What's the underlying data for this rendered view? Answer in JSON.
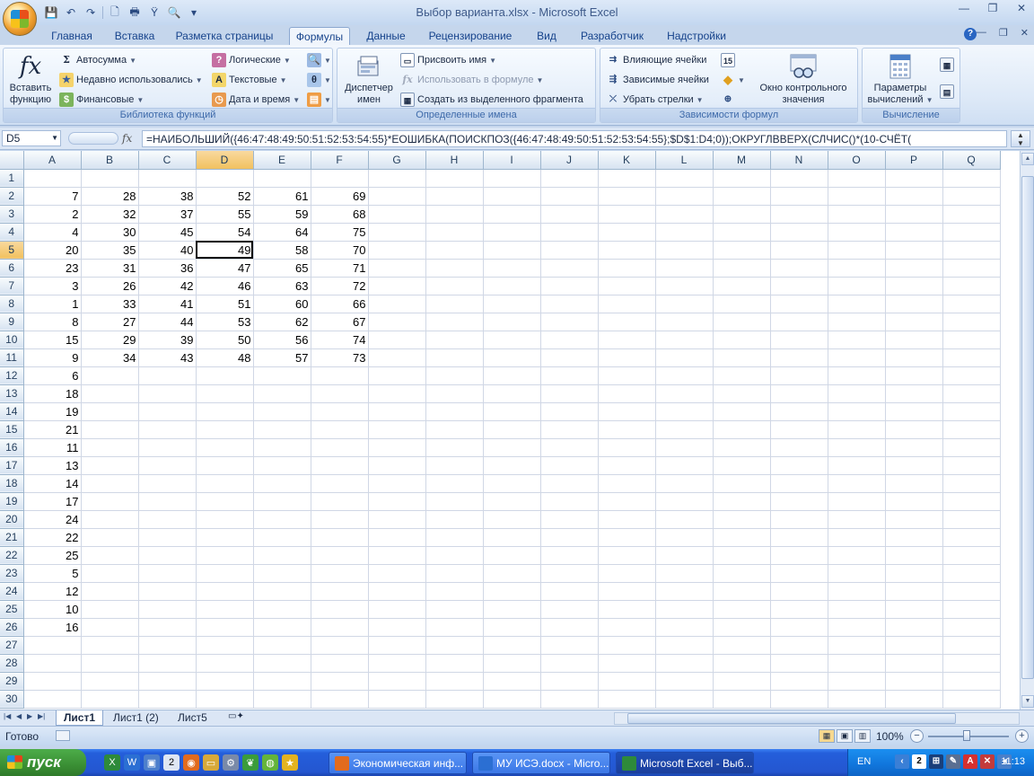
{
  "window": {
    "title": "Выбор варианта.xlsx - Microsoft Excel"
  },
  "ribbon_tabs": [
    "Главная",
    "Вставка",
    "Разметка страницы",
    "Формулы",
    "Данные",
    "Рецензирование",
    "Вид",
    "Разработчик",
    "Надстройки"
  ],
  "active_tab": "Формулы",
  "ribbon": {
    "library": {
      "insert_function": "Вставить функцию",
      "insert_function_line1": "Вставить",
      "insert_function_line2": "функцию",
      "autosum": "Автосумма",
      "recent": "Недавно использовались",
      "financial": "Финансовые",
      "logical": "Логические",
      "text": "Текстовые",
      "datetime": "Дата и время",
      "label": "Библиотека функций"
    },
    "names": {
      "manager_line1": "Диспетчер",
      "manager_line2": "имен",
      "assign": "Присвоить имя",
      "use_in_formula": "Использовать в формуле",
      "create_from_selection": "Создать из выделенного фрагмента",
      "label": "Определенные имена"
    },
    "audit": {
      "precedents": "Влияющие ячейки",
      "dependents": "Зависимые ячейки",
      "remove_arrows": "Убрать стрелки",
      "watch_line1": "Окно контрольного",
      "watch_line2": "значения",
      "label": "Зависимости формул"
    },
    "calc": {
      "options_line1": "Параметры",
      "options_line2": "вычислений",
      "label": "Вычисление"
    }
  },
  "formula_bar": {
    "name_box": "D5",
    "fx": "fx",
    "formula": "=НАИБОЛЬШИЙ({46:47:48:49:50:51:52:53:54:55}*ЕОШИБКА(ПОИСКПОЗ({46:47:48:49:50:51:52:53:54:55};$D$1:D4;0));ОКРУГЛВВЕРХ(СЛЧИС()*(10-СЧЁТ("
  },
  "grid": {
    "columns": [
      "A",
      "B",
      "C",
      "D",
      "E",
      "F",
      "G",
      "H",
      "I",
      "J",
      "K",
      "L",
      "M",
      "N",
      "O",
      "P",
      "Q"
    ],
    "selected_column": "D",
    "selected_row": 5,
    "rows": [
      {
        "n": "1",
        "cells": [
          "",
          "",
          "",
          "",
          "",
          ""
        ]
      },
      {
        "n": "2",
        "cells": [
          "7",
          "28",
          "38",
          "52",
          "61",
          "69"
        ]
      },
      {
        "n": "3",
        "cells": [
          "2",
          "32",
          "37",
          "55",
          "59",
          "68"
        ]
      },
      {
        "n": "4",
        "cells": [
          "4",
          "30",
          "45",
          "54",
          "64",
          "75"
        ]
      },
      {
        "n": "5",
        "cells": [
          "20",
          "35",
          "40",
          "49",
          "58",
          "70"
        ]
      },
      {
        "n": "6",
        "cells": [
          "23",
          "31",
          "36",
          "47",
          "65",
          "71"
        ]
      },
      {
        "n": "7",
        "cells": [
          "3",
          "26",
          "42",
          "46",
          "63",
          "72"
        ]
      },
      {
        "n": "8",
        "cells": [
          "1",
          "33",
          "41",
          "51",
          "60",
          "66"
        ]
      },
      {
        "n": "9",
        "cells": [
          "8",
          "27",
          "44",
          "53",
          "62",
          "67"
        ]
      },
      {
        "n": "10",
        "cells": [
          "15",
          "29",
          "39",
          "50",
          "56",
          "74"
        ]
      },
      {
        "n": "11",
        "cells": [
          "9",
          "34",
          "43",
          "48",
          "57",
          "73"
        ]
      },
      {
        "n": "12",
        "cells": [
          "6",
          "",
          "",
          "",
          "",
          ""
        ]
      },
      {
        "n": "13",
        "cells": [
          "18",
          "",
          "",
          "",
          "",
          ""
        ]
      },
      {
        "n": "14",
        "cells": [
          "19",
          "",
          "",
          "",
          "",
          ""
        ]
      },
      {
        "n": "15",
        "cells": [
          "21",
          "",
          "",
          "",
          "",
          ""
        ]
      },
      {
        "n": "16",
        "cells": [
          "11",
          "",
          "",
          "",
          "",
          ""
        ]
      },
      {
        "n": "17",
        "cells": [
          "13",
          "",
          "",
          "",
          "",
          ""
        ]
      },
      {
        "n": "18",
        "cells": [
          "14",
          "",
          "",
          "",
          "",
          ""
        ]
      },
      {
        "n": "19",
        "cells": [
          "17",
          "",
          "",
          "",
          "",
          ""
        ]
      },
      {
        "n": "20",
        "cells": [
          "24",
          "",
          "",
          "",
          "",
          ""
        ]
      },
      {
        "n": "21",
        "cells": [
          "22",
          "",
          "",
          "",
          "",
          ""
        ]
      },
      {
        "n": "22",
        "cells": [
          "25",
          "",
          "",
          "",
          "",
          ""
        ]
      },
      {
        "n": "23",
        "cells": [
          "5",
          "",
          "",
          "",
          "",
          ""
        ]
      },
      {
        "n": "24",
        "cells": [
          "12",
          "",
          "",
          "",
          "",
          ""
        ]
      },
      {
        "n": "25",
        "cells": [
          "10",
          "",
          "",
          "",
          "",
          ""
        ]
      },
      {
        "n": "26",
        "cells": [
          "16",
          "",
          "",
          "",
          "",
          ""
        ]
      },
      {
        "n": "27",
        "cells": [
          "",
          "",
          "",
          "",
          "",
          ""
        ]
      },
      {
        "n": "28",
        "cells": [
          "",
          "",
          "",
          "",
          "",
          ""
        ]
      },
      {
        "n": "29",
        "cells": [
          "",
          "",
          "",
          "",
          "",
          ""
        ]
      },
      {
        "n": "30",
        "cells": [
          "",
          "",
          "",
          "",
          "",
          ""
        ]
      }
    ]
  },
  "sheets": [
    "Лист1",
    "Лист1 (2)",
    "Лист5"
  ],
  "active_sheet": "Лист1",
  "status": {
    "ready": "Готово",
    "zoom": "100%"
  },
  "taskbar": {
    "start": "пуск",
    "items": [
      {
        "label": "Экономическая инф...",
        "active": false
      },
      {
        "label": "МУ ИСЭ.docx - Micro...",
        "active": false
      },
      {
        "label": "Microsoft Excel - Выб...",
        "active": true
      }
    ],
    "lang": "EN",
    "clock": "11:13",
    "quicklaunch_badge": "2",
    "tray_badge": "2"
  },
  "colors": {
    "accent": "#15428b",
    "selection_header": "#f1c15f",
    "taskbar": "#245edb",
    "start_green": "#3a8f34"
  }
}
